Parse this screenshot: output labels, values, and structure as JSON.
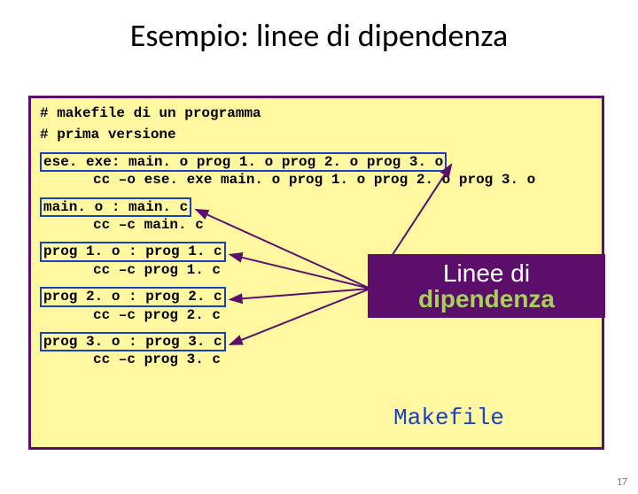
{
  "title": "Esempio: linee di dipendenza",
  "code": {
    "comment1": "# makefile di un programma",
    "comment2": "# prima versione",
    "r1_head": "ese. exe: main. o prog 1. o prog 2. o prog 3. o",
    "r1_cmd": "cc –o ese. exe main. o prog 1. o prog 2. o prog 3. o",
    "r2_head": "main. o : main. c",
    "r2_cmd": "cc –c main. c",
    "r3_head": "prog 1. o : prog 1. c",
    "r3_cmd": "cc –c prog 1. c",
    "r4_head": "prog 2. o : prog 2. c",
    "r4_cmd": "cc –c prog 2. c",
    "r5_head": "prog 3. o : prog 3. c",
    "r5_cmd": "cc –c prog 3. c"
  },
  "callout": {
    "line1": "Linee di",
    "line2": "dipendenza"
  },
  "label": "Makefile",
  "pagenum": "17",
  "colors": {
    "box_border": "#5b0f6b",
    "box_bg": "#fff8a0",
    "hl_border": "#1b3fc1",
    "callout_bg": "#5b0f6b",
    "callout_accent": "#a8d05a",
    "label_color": "#1b3fc1"
  }
}
